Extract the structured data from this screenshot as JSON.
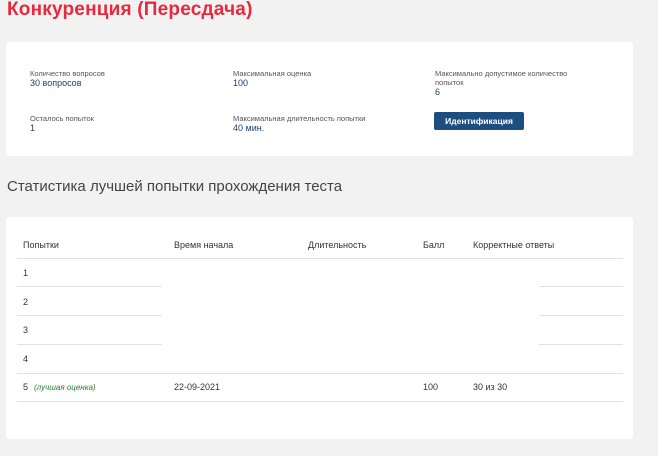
{
  "page": {
    "title": "Конкуренция (Пересдача)"
  },
  "info": {
    "questions_count": {
      "label": "Количество вопросов",
      "value": "30 вопросов"
    },
    "max_score": {
      "label": "Максимальная оценка",
      "value": "100"
    },
    "max_attempts": {
      "label": "Максимально допустимое количество попыток",
      "value": "6"
    },
    "remaining_attempts": {
      "label": "Осталось попыток",
      "value": "1"
    },
    "max_duration": {
      "label": "Максимальная длительность попытки",
      "value": "40 мин."
    },
    "identification_button": "Идентификация"
  },
  "stats": {
    "title": "Статистика лучшей попытки прохождения теста",
    "columns": {
      "attempts": "Попытки",
      "start_time": "Время начала",
      "duration": "Длительность",
      "score": "Балл",
      "correct": "Корректные ответы"
    },
    "rows": [
      {
        "attempt": "1",
        "start_time": "",
        "duration": "",
        "score": "",
        "correct": "",
        "note": ""
      },
      {
        "attempt": "2",
        "start_time": "",
        "duration": "",
        "score": "",
        "correct": "",
        "note": ""
      },
      {
        "attempt": "3",
        "start_time": "",
        "duration": "",
        "score": "",
        "correct": "",
        "note": ""
      },
      {
        "attempt": "4",
        "start_time": "",
        "duration": "",
        "score": "",
        "correct": "",
        "note": ""
      },
      {
        "attempt": "5",
        "start_time": "22-09-2021",
        "duration": "",
        "score": "100",
        "correct": "30 из 30",
        "note": "(лучшая оценка)"
      }
    ]
  }
}
